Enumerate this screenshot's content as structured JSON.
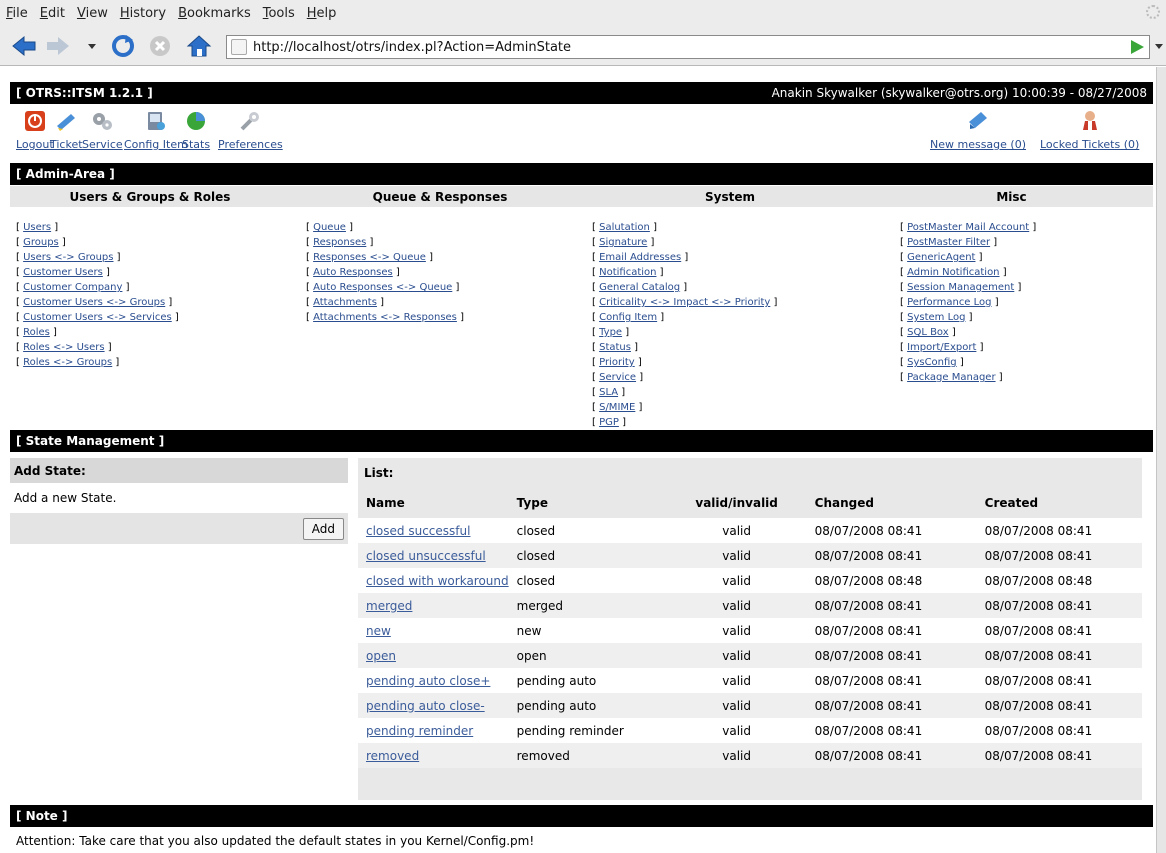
{
  "browser": {
    "menu": [
      "File",
      "Edit",
      "View",
      "History",
      "Bookmarks",
      "Tools",
      "Help"
    ],
    "url": "http://localhost/otrs/index.pl?Action=AdminState"
  },
  "header": {
    "product": "[ OTRS::ITSM 1.2.1 ]",
    "user_info": "Anakin Skywalker (skywalker@otrs.org) 10:00:39 - 08/27/2008"
  },
  "toolbar": {
    "left": [
      {
        "label": "Logout",
        "icon": "logout-icon"
      },
      {
        "label": "Ticket",
        "icon": "ticket-icon"
      },
      {
        "label": "Service",
        "icon": "service-icon"
      },
      {
        "label": "Config Item",
        "icon": "config-item-icon"
      },
      {
        "label": "Stats",
        "icon": "stats-icon"
      },
      {
        "label": "Preferences",
        "icon": "preferences-icon"
      }
    ],
    "right": [
      {
        "label": "New message (0)",
        "icon": "new-message-icon"
      },
      {
        "label": "Locked Tickets (0)",
        "icon": "locked-tickets-icon"
      }
    ]
  },
  "admin": {
    "title": "[ Admin-Area ]",
    "columns": [
      {
        "title": "Users & Groups & Roles",
        "items": [
          "Users",
          "Groups",
          "Users <-> Groups",
          "Customer Users",
          "Customer Company",
          "Customer Users <-> Groups",
          "Customer Users <-> Services",
          "Roles",
          "Roles <-> Users",
          "Roles <-> Groups"
        ]
      },
      {
        "title": "Queue & Responses",
        "items": [
          "Queue",
          "Responses",
          "Responses <-> Queue",
          "Auto Responses",
          "Auto Responses <-> Queue",
          "Attachments",
          "Attachments <-> Responses"
        ]
      },
      {
        "title": "System",
        "items": [
          "Salutation",
          "Signature",
          "Email Addresses",
          "Notification",
          "General Catalog",
          "Criticality <-> Impact <-> Priority",
          "Config Item",
          "Type",
          "Status",
          "Priority",
          "Service",
          "SLA",
          "S/MIME",
          "PGP"
        ]
      },
      {
        "title": "Misc",
        "items": [
          "PostMaster Mail Account",
          "PostMaster Filter",
          "GenericAgent",
          "Admin Notification",
          "Session Management",
          "Performance Log",
          "System Log",
          "SQL Box",
          "Import/Export",
          "SysConfig",
          "Package Manager"
        ]
      }
    ]
  },
  "state": {
    "title": "[ State Management ]",
    "add_title": "Add State:",
    "add_desc": "Add a new State.",
    "add_button": "Add",
    "list_title": "List:",
    "columns": [
      "Name",
      "Type",
      "valid/invalid",
      "Changed",
      "Created"
    ],
    "rows": [
      [
        "closed successful",
        "closed",
        "valid",
        "08/07/2008 08:41",
        "08/07/2008 08:41"
      ],
      [
        "closed unsuccessful",
        "closed",
        "valid",
        "08/07/2008 08:41",
        "08/07/2008 08:41"
      ],
      [
        "closed with workaround",
        "closed",
        "valid",
        "08/07/2008 08:48",
        "08/07/2008 08:48"
      ],
      [
        "merged",
        "merged",
        "valid",
        "08/07/2008 08:41",
        "08/07/2008 08:41"
      ],
      [
        "new",
        "new",
        "valid",
        "08/07/2008 08:41",
        "08/07/2008 08:41"
      ],
      [
        "open",
        "open",
        "valid",
        "08/07/2008 08:41",
        "08/07/2008 08:41"
      ],
      [
        "pending auto close+",
        "pending auto",
        "valid",
        "08/07/2008 08:41",
        "08/07/2008 08:41"
      ],
      [
        "pending auto close-",
        "pending auto",
        "valid",
        "08/07/2008 08:41",
        "08/07/2008 08:41"
      ],
      [
        "pending reminder",
        "pending reminder",
        "valid",
        "08/07/2008 08:41",
        "08/07/2008 08:41"
      ],
      [
        "removed",
        "removed",
        "valid",
        "08/07/2008 08:41",
        "08/07/2008 08:41"
      ]
    ]
  },
  "note": {
    "title": "[ Note ]",
    "text": "Attention: Take care that you also updated the default states in you Kernel/Config.pm!"
  }
}
